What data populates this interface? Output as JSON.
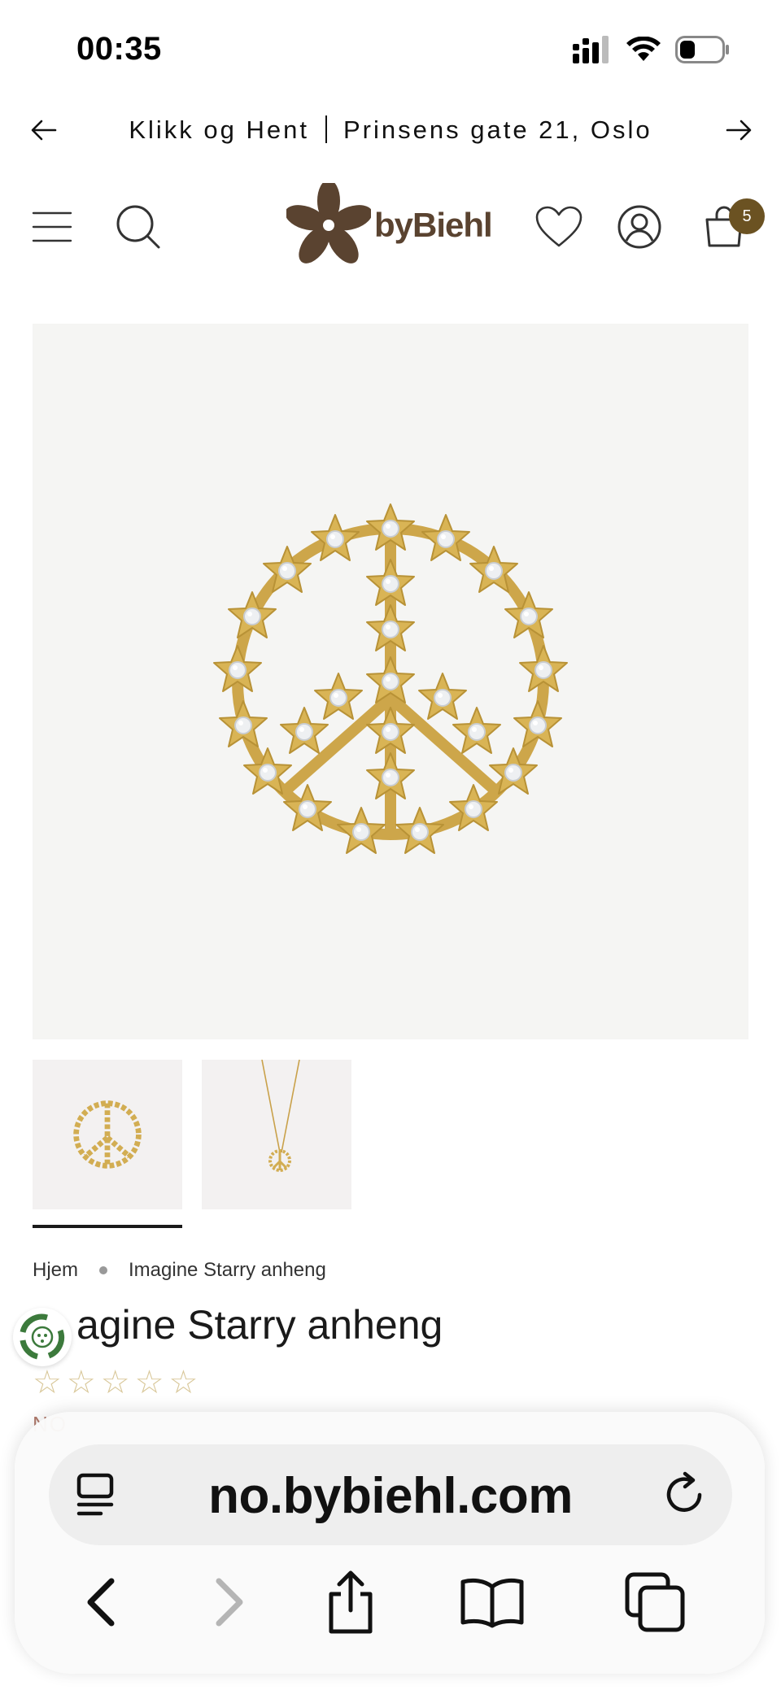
{
  "status_bar": {
    "time": "00:35",
    "battery_level": 0.3
  },
  "announcement": {
    "left_text": "Klikk og Hent",
    "right_text": "Prinsens gate 21, Oslo"
  },
  "header": {
    "logo_text": "byBiehl",
    "cart_count": "5",
    "brand_color": "#5a4330",
    "badge_color": "#6b5222"
  },
  "product": {
    "breadcrumb": [
      "Hjem",
      "Imagine Starry anheng"
    ],
    "title_visible": "agine Starry anheng",
    "rating_stars": 0,
    "rating_max": 5,
    "price_peek": "NO",
    "image_count": 2,
    "active_thumbnail": 0
  },
  "browser": {
    "url": "no.bybiehl.com",
    "icons": [
      "reader-icon",
      "reload-icon",
      "back-icon",
      "forward-icon",
      "share-icon",
      "bookmarks-icon",
      "tabs-icon"
    ]
  }
}
